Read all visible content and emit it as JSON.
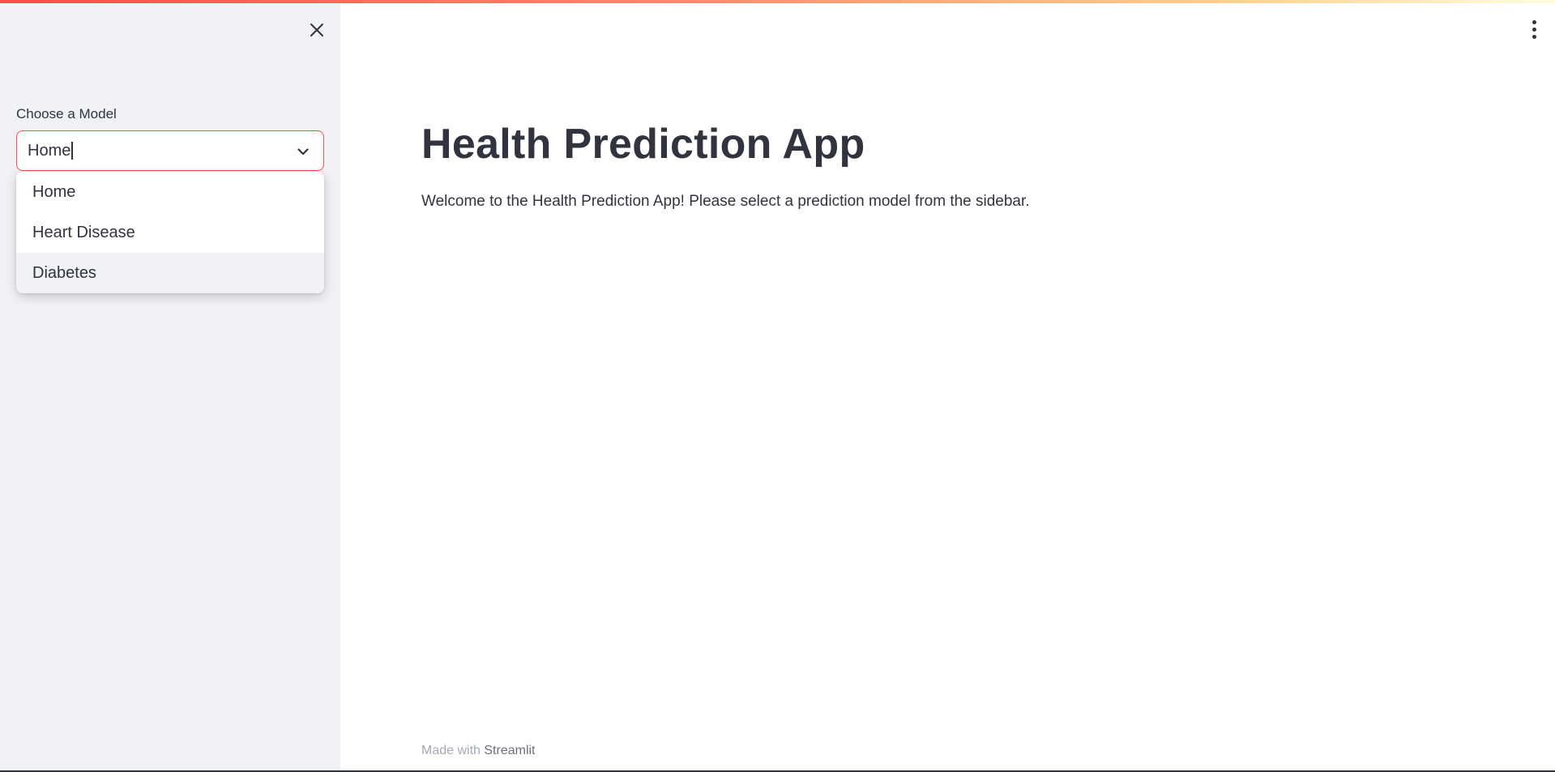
{
  "colors": {
    "accent": "#ff4b4b",
    "sidebar_bg": "#f0f2f6",
    "text": "#31333f"
  },
  "sidebar": {
    "close_icon": "close-icon",
    "select": {
      "label": "Choose a Model",
      "value": "Home",
      "icon": "chevron-down-icon",
      "options": [
        "Home",
        "Heart Disease",
        "Diabetes"
      ],
      "hovered_option": "Diabetes"
    }
  },
  "header": {
    "menu_icon": "kebab-menu-icon"
  },
  "main": {
    "title": "Health Prediction App",
    "welcome": "Welcome to the Health Prediction App! Please select a prediction model from the sidebar."
  },
  "footer": {
    "prefix": "Made with",
    "brand": "Streamlit"
  }
}
